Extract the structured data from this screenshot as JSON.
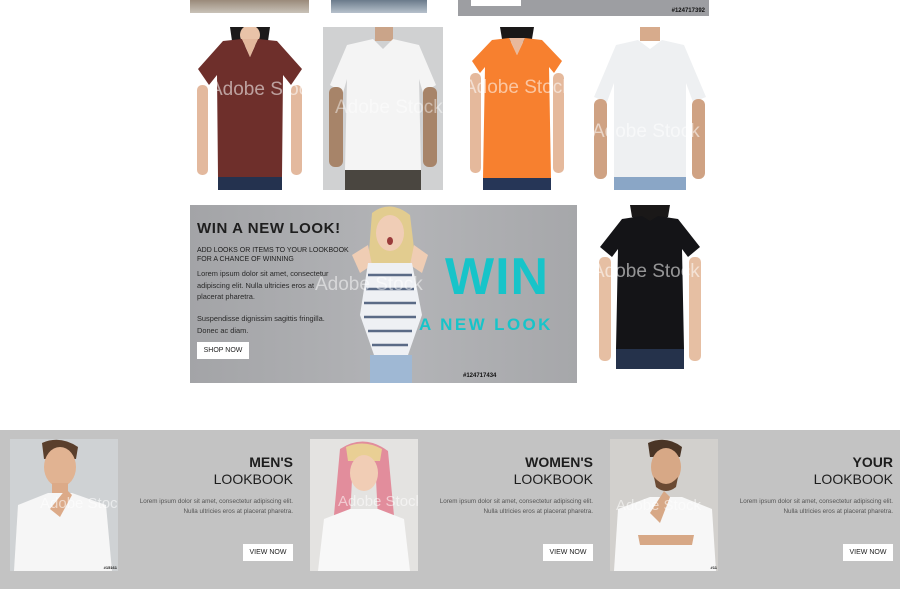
{
  "top": {
    "stock_id": "#124717392"
  },
  "products": [
    {
      "name": "Maroon V-neck tee",
      "color": "#6e2f2b",
      "watermark": "Adobe Stock"
    },
    {
      "name": "White crew tee",
      "color": "#f2f2f2",
      "watermark": "Adobe Stock"
    },
    {
      "name": "Orange V-neck tee",
      "color": "#f7802f",
      "watermark": "Adobe Stock"
    },
    {
      "name": "White crew tee",
      "color": "#eef0f2",
      "watermark": "Adobe Stock"
    },
    {
      "name": "Black crew tee",
      "color": "#141417",
      "watermark": "Adobe Stock"
    }
  ],
  "promo": {
    "title": "WIN A NEW LOOK!",
    "subtitle": "ADD LOOKS OR ITEMS TO YOUR LOOKBOOK FOR A CHANCE OF WINNING",
    "text1": "Lorem ipsum dolor sit amet, consectetur adipiscing elit. Nulla ultricies eros at placerat pharetra.",
    "text2": "Suspendisse dignissim sagittis fringilla. Donec ac diam.",
    "button": "SHOP NOW",
    "big_win": "WIN",
    "big_newlook": "A NEW LOOK",
    "stock_id": "#124717434",
    "watermark": "Adobe Stock",
    "accent": "#17c4c9"
  },
  "lookbooks": [
    {
      "title1": "MEN'S",
      "title2": "LOOKBOOK",
      "text": "Lorem ipsum dolor sit amet, consectetur adipiscing elit. Nulla ultricies eros at placerat pharetra.",
      "button": "VIEW NOW",
      "stock_id": "#15161",
      "watermark": "Adobe Stock"
    },
    {
      "title1": "WOMEN'S",
      "title2": "LOOKBOOK",
      "text": "Lorem ipsum dolor sit amet, consectetur adipiscing elit. Nulla ultricies eros at placerat pharetra.",
      "button": "VIEW NOW",
      "stock_id": "",
      "watermark": "Adobe Stock"
    },
    {
      "title1": "YOUR",
      "title2": "LOOKBOOK",
      "text": "Lorem ipsum dolor sit amet, consectetur adipiscing elit. Nulla ultricies eros at placerat pharetra.",
      "button": "VIEW NOW",
      "stock_id": "#11",
      "watermark": "Adobe Stock"
    }
  ]
}
